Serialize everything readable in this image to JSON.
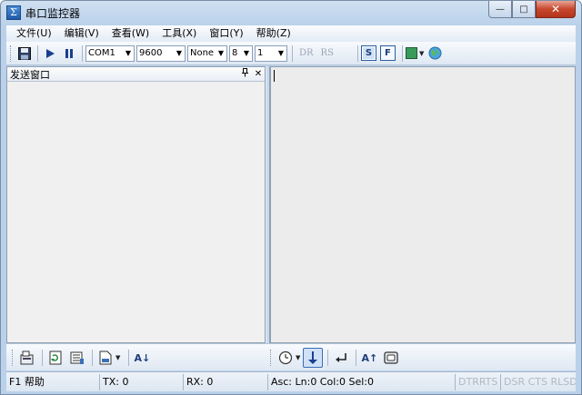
{
  "window": {
    "title": "串口监控器",
    "app_icon_glyph": "Σ"
  },
  "title_controls": {
    "minimize": "—",
    "maximize": "□",
    "close": "✕"
  },
  "menu": [
    "文件(U)",
    "编辑(V)",
    "查看(W)",
    "工具(X)",
    "窗口(Y)",
    "帮助(Z)"
  ],
  "toolbar": {
    "port": "COM1",
    "baud": "9600",
    "parity": "None",
    "data_bits": "8",
    "stop_bits": "1",
    "dr_label": "DR",
    "rs_label": "RS",
    "s_label": "S",
    "f_label": "F"
  },
  "send_pane": {
    "title": "发送窗口",
    "pin": "ᵖ",
    "close": "✕"
  },
  "bottom_toolbar": {
    "sort_label": "A↓",
    "font_label": "A↑"
  },
  "status": {
    "help": "F1 帮助",
    "tx": "TX: 0",
    "rx": "RX: 0",
    "pos": "Asc: Ln:0  Col:0  Sel:0",
    "dtr_rts": "DTRRTS",
    "dsr_cts": "DSR CTS RLSD"
  },
  "colors": {
    "accent": "#2a5ea0",
    "frame": "#b9d1ea",
    "close": "#c7472e"
  }
}
